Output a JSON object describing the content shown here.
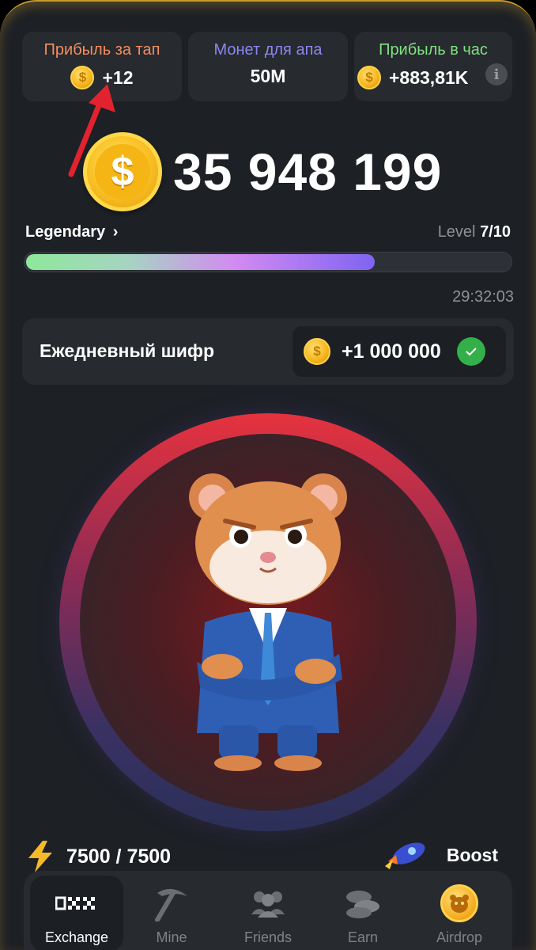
{
  "stats": [
    {
      "label": "Прибыль за тап",
      "value": "+12",
      "label_color": "#f38e62"
    },
    {
      "label": "Монет для апа",
      "value": "50M",
      "label_color": "#8d86ef"
    },
    {
      "label": "Прибыль в час",
      "value": "+883,81K",
      "label_color": "#7fe27f"
    }
  ],
  "coin_symbol": "$",
  "balance": "35 948 199",
  "league": "Legendary",
  "level": {
    "prefix": "Level",
    "value": "7/10",
    "progress_fraction": 0.72
  },
  "timer": "29:32:03",
  "cipher": {
    "title": "Ежедневный шифр",
    "reward": "+1 000 000"
  },
  "energy": "7500 / 7500",
  "boost_label": "Boost",
  "nav": [
    {
      "label": "Exchange",
      "icon": "exchange-icon",
      "active": true
    },
    {
      "label": "Mine",
      "icon": "pickaxe-icon",
      "active": false
    },
    {
      "label": "Friends",
      "icon": "friends-icon",
      "active": false
    },
    {
      "label": "Earn",
      "icon": "coins-icon",
      "active": false
    },
    {
      "label": "Airdrop",
      "icon": "airdrop-hamster-coin-icon",
      "active": false
    }
  ],
  "colors": {
    "accent_gold": "#f6b91e",
    "background": "#1d2025",
    "card": "#272a2f",
    "check_green": "#34b04a"
  }
}
